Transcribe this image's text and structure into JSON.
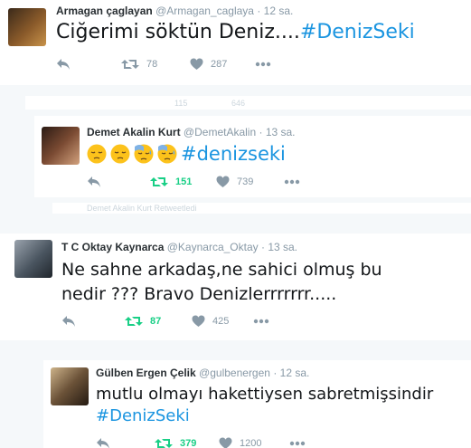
{
  "tweets": [
    {
      "name": "Armagan çaglayan",
      "handle": "@Armagan_caglaya",
      "time": "· 12 sa.",
      "text": "Ciğerimi söktün Deniz....",
      "hashtag": "#DenizSeki",
      "retweets": "78",
      "likes": "287"
    },
    {
      "name": "Demet Akalin Kurt",
      "handle": "@DemetAkalin",
      "time": "· 13 sa.",
      "hashtag": "#denizseki",
      "emojis": [
        "pensive-face",
        "pensive-face",
        "downcast-face-with-sweat",
        "downcast-face-with-sweat"
      ],
      "retweets": "151",
      "likes": "739"
    },
    {
      "name": "T C Oktay Kaynarca",
      "handle": "@Kaynarca_Oktay",
      "time": "· 13 sa.",
      "text_line1": "Ne sahne arkadaş,ne sahici olmuş bu",
      "text_line2": "nedir ??? Bravo Denizlerrrrrrr.....",
      "retweets": "87",
      "likes": "425"
    },
    {
      "name": "Gülben Ergen Çelik",
      "handle": "@gulbenergen",
      "time": "· 12 sa.",
      "text": "mutlu olmayı hakettiysen sabretmişsindir",
      "hashtag": "#DenizSeki",
      "retweets": "379",
      "likes": "1200"
    }
  ],
  "fragments": {
    "counts_a_retweets": "115",
    "counts_a_likes": "646",
    "retweeted_line": "Demet Akalin Kurt Retweetledi"
  },
  "colors": {
    "hashtag": "#1b95e0",
    "retweet_active": "#19cf86",
    "muted": "#8899a6",
    "background": "#f5f8fa"
  },
  "icons": [
    "reply-icon",
    "retweet-icon",
    "like-icon",
    "more-icon"
  ]
}
